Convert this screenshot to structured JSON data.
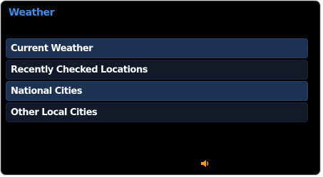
{
  "screen": {
    "title": "Weather"
  },
  "menu": {
    "items": [
      {
        "label": "Current Weather"
      },
      {
        "label": "Recently Checked Locations"
      },
      {
        "label": "National Cities"
      },
      {
        "label": "Other Local Cities"
      }
    ]
  },
  "status": {
    "icon": "speaker-icon",
    "icon_color": "#f29a1a"
  },
  "colors": {
    "title": "#3f8ce8",
    "background": "#000000",
    "row_dark": "#121a2a",
    "row_light": "#1d3152",
    "text": "#ffffff"
  }
}
